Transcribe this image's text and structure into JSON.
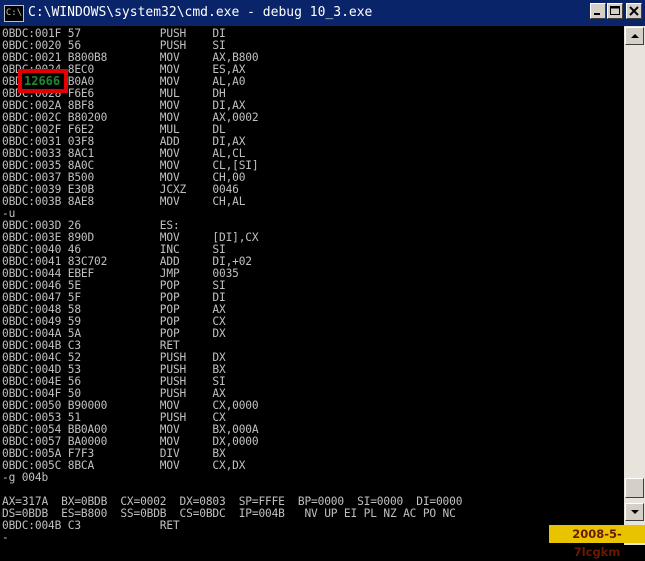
{
  "window": {
    "title": "C:\\WINDOWS\\system32\\cmd.exe - debug 10_3.exe",
    "system_icon_text": "C:\\",
    "buttons": {
      "minimize": "minimize",
      "maximize": "maximize",
      "close": "close"
    }
  },
  "console": {
    "lines": [
      "0BDC:001F 57            PUSH    DI",
      "0BDC:0020 56            PUSH    SI",
      "0BDC:0021 B800B8        MOV     AX,B800",
      "0BDC:0024 8EC0          MOV     ES,AX",
      "0BDC:0026 B0A0          MOV     AL,A0",
      "0BDC:0028 F6E6          MUL     DH",
      "0BDC:002A 8BF8          MOV     DI,AX",
      "0BDC:002C B80200        MOV     AX,0002",
      "0BDC:002F F6E2          MUL     DL",
      "0BDC:0031 03F8          ADD     DI,AX",
      "0BDC:0033 8AC1          MOV     AL,CL",
      "0BDC:0035 8A0C          MOV     CL,[SI]",
      "0BDC:0037 B500          MOV     CH,00",
      "0BDC:0039 E30B          JCXZ    0046",
      "0BDC:003B 8AE8          MOV     CH,AL",
      "-u",
      "0BDC:003D 26            ES:",
      "0BDC:003E 890D          MOV     [DI],CX",
      "0BDC:0040 46            INC     SI",
      "0BDC:0041 83C702        ADD     DI,+02",
      "0BDC:0044 EBEF          JMP     0035",
      "0BDC:0046 5E            POP     SI",
      "0BDC:0047 5F            POP     DI",
      "0BDC:0048 58            POP     AX",
      "0BDC:0049 59            POP     CX",
      "0BDC:004A 5A            POP     DX",
      "0BDC:004B C3            RET",
      "0BDC:004C 52            PUSH    DX",
      "0BDC:004D 53            PUSH    BX",
      "0BDC:004E 56            PUSH    SI",
      "0BDC:004F 50            PUSH    AX",
      "0BDC:0050 B90000        MOV     CX,0000",
      "0BDC:0053 51            PUSH    CX",
      "0BDC:0054 BB0A00        MOV     BX,000A",
      "0BDC:0057 BA0000        MOV     DX,0000",
      "0BDC:005A F7F3          DIV     BX",
      "0BDC:005C 8BCA          MOV     CX,DX",
      "-g 004b",
      "",
      "AX=317A  BX=0BDB  CX=0002  DX=0803  SP=FFFE  BP=0000  SI=0000  DI=0000",
      "DS=0BDB  ES=B800  SS=0BDB  CS=0BDC  IP=004B   NV UP EI PL NZ AC PO NC",
      "0BDC:004B C3            RET",
      "-"
    ]
  },
  "highlight": {
    "text": "12666"
  },
  "stamp": {
    "text": "2008-5-7lcgkm"
  },
  "colors": {
    "titlebar": "#0a246a",
    "console_bg": "#000000",
    "console_text": "#c0c0c0",
    "highlight_border": "#e00000",
    "highlight_text": "#1c8a2f",
    "stamp_bg": "#e8c400"
  }
}
